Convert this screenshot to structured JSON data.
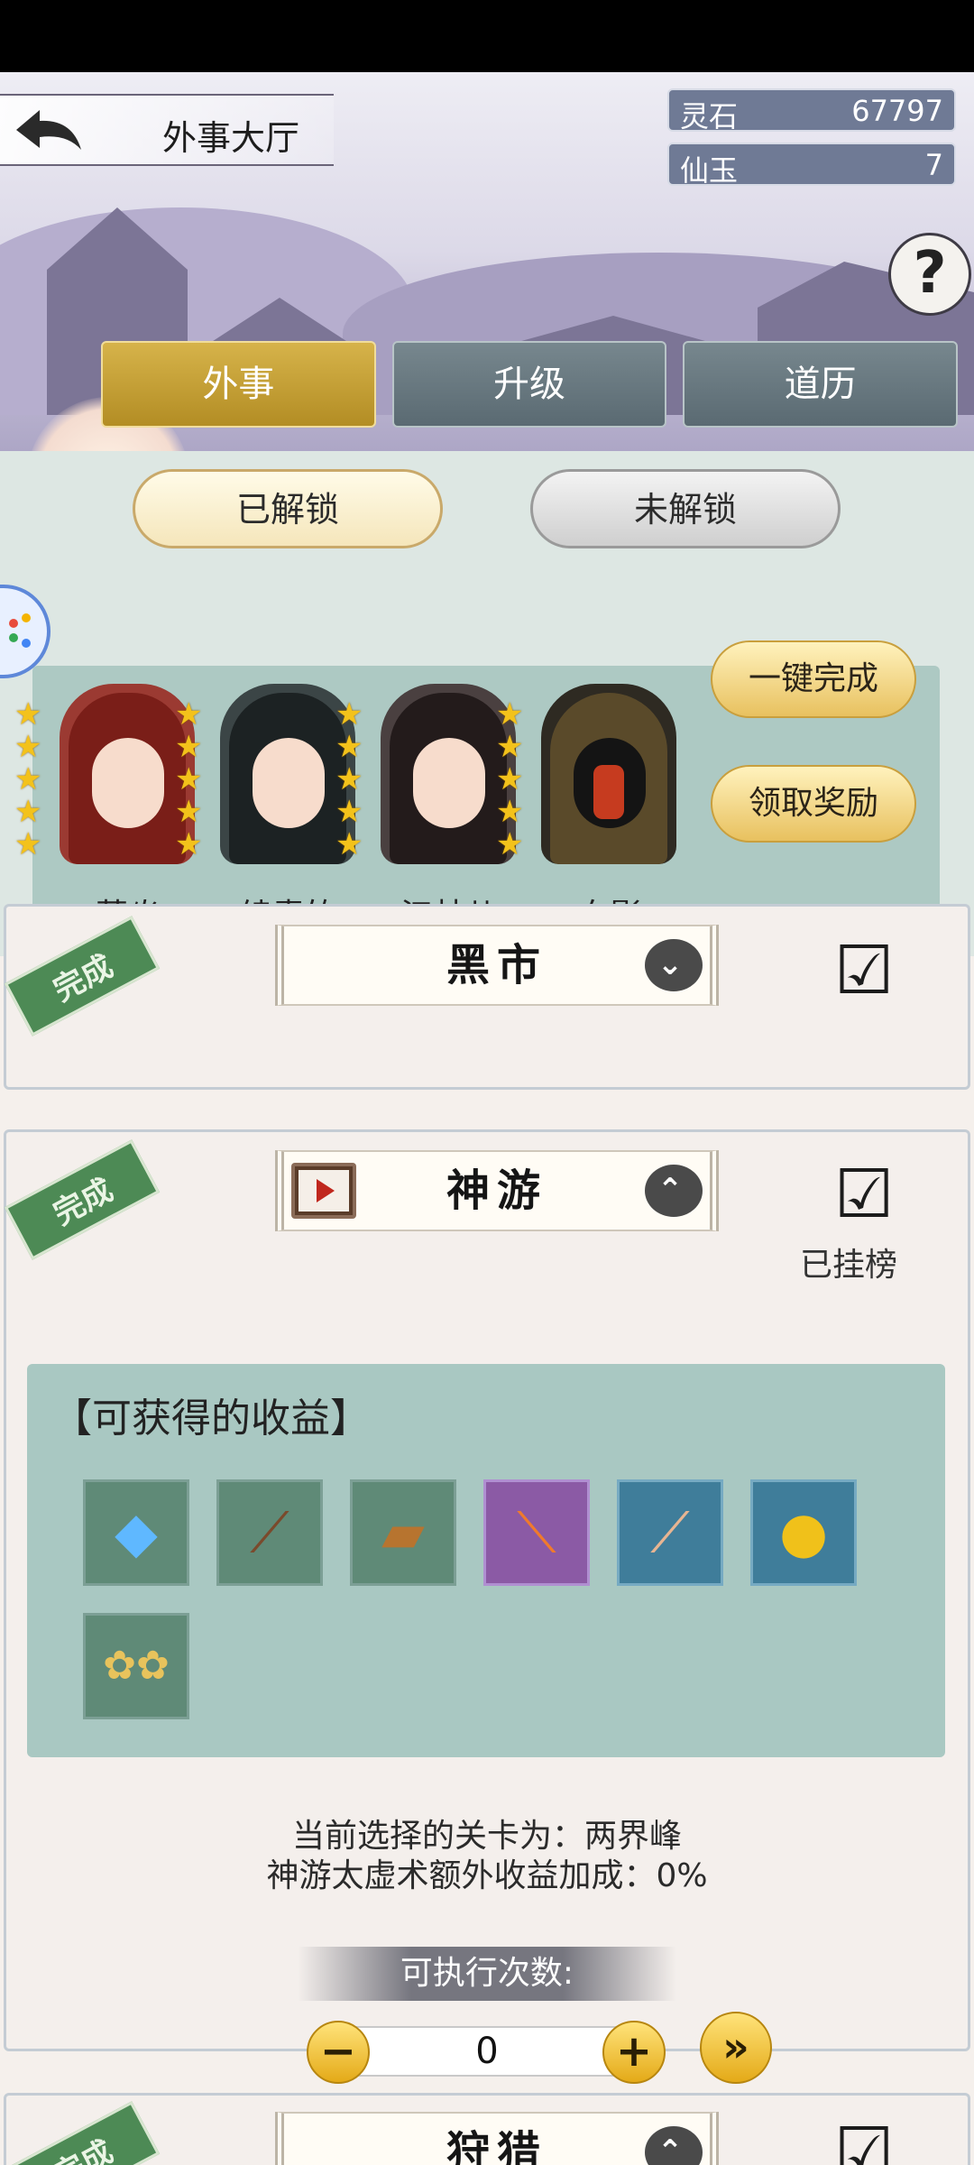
{
  "header": {
    "title": "外事大厅",
    "currencies": [
      {
        "name": "灵石",
        "value": "67797"
      },
      {
        "name": "仙玉",
        "value": "7"
      }
    ],
    "help_glyph": "?"
  },
  "tabs": [
    "外事",
    "升级",
    "道历"
  ],
  "sub_tabs": [
    "已解锁",
    "未解锁"
  ],
  "heroes": [
    {
      "name": "萧焱",
      "stars": 5
    },
    {
      "name": "绫青竹",
      "stars": 5
    },
    {
      "name": "江林儿",
      "stars": 5
    },
    {
      "name": "血影",
      "stars": 5
    }
  ],
  "actions": {
    "complete_all": "一键完成",
    "claim_reward": "领取奖励"
  },
  "tasks": [
    {
      "stamp": "完成",
      "title": "黑市",
      "expanded": false
    },
    {
      "stamp": "完成",
      "title": "神游",
      "expanded": true,
      "status": "已挂榜"
    },
    {
      "stamp": "完成",
      "title": "狩猎",
      "expanded": true
    }
  ],
  "rewards": {
    "title": "【可获得的收益】",
    "items": [
      "crystal-icon",
      "branch-icon",
      "wood-block-icon",
      "spear-icon",
      "scroll-icon",
      "gold-pill-icon",
      "flowers-icon"
    ]
  },
  "stage_info": {
    "line1": "当前选择的关卡为：两界峰",
    "line2": "神游太虚术额外收益加成：0%"
  },
  "executions": {
    "label": "可执行次数:",
    "value": "0"
  },
  "colors": {
    "tab_active": "#c9a33a",
    "tab_inactive": "#66767e",
    "stamp": "#4d8a55"
  }
}
